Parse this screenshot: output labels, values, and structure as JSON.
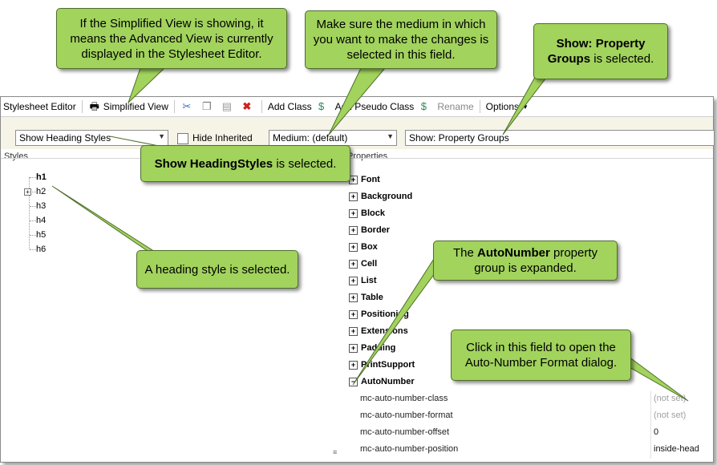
{
  "toolbar": {
    "title": "Stylesheet Editor",
    "simplified_view": "Simplified View",
    "add_class": "Add Class",
    "add_pseudo_class": "Add Pseudo Class",
    "rename": "Rename",
    "options": "Options"
  },
  "filters": {
    "show_styles": "Show Heading Styles",
    "hide_inherited": "Hide Inherited",
    "medium": "Medium: (default)",
    "show_view": "Show: Property Groups"
  },
  "styles": {
    "label": "Styles",
    "items": [
      "h1",
      "h2",
      "h3",
      "h4",
      "h5",
      "h6"
    ]
  },
  "properties": {
    "label": "Properties",
    "groups": [
      "Font",
      "Background",
      "Block",
      "Border",
      "Box",
      "Cell",
      "List",
      "Table",
      "Positioning",
      "Extensions",
      "Padding",
      "PrintSupport",
      "AutoNumber"
    ],
    "autonumber_rows": [
      {
        "name": "mc-auto-number-class",
        "value": "(not set)"
      },
      {
        "name": "mc-auto-number-format",
        "value": "(not set)"
      },
      {
        "name": "mc-auto-number-offset",
        "value": "0"
      },
      {
        "name": "mc-auto-number-position",
        "value": "inside-head"
      }
    ]
  },
  "callouts": {
    "simplified": "If the Simplified View is showing, it means the Advanced View is currently displayed in the Stylesheet Editor.",
    "medium": "Make sure the medium in which you want to make the changes is selected in this field.",
    "show_pg_bold": "Show: Property Groups",
    "show_pg_rest": " is selected.",
    "heading_bold": "Show HeadingStyles",
    "heading_rest": " is selected.",
    "heading_style": "A heading style is selected.",
    "autonumber_pre": "The ",
    "autonumber_bold": "AutoNumber",
    "autonumber_rest": " property group is expanded.",
    "click_field": "Click in this field to open the Auto-Number Format dialog."
  },
  "colors": {
    "callout_fill": "#a2d35d",
    "callout_border": "#4f6d2c",
    "filter_bar": "#f6f4e7",
    "delete_red": "#cc2222",
    "cut_blue": "#3a6fc4"
  },
  "icons": [
    "simplified-view-icon",
    "cut-icon",
    "copy-icon",
    "paste-icon",
    "delete-icon",
    "add-class-icon",
    "add-pseudo-class-icon",
    "rename-icon"
  ]
}
